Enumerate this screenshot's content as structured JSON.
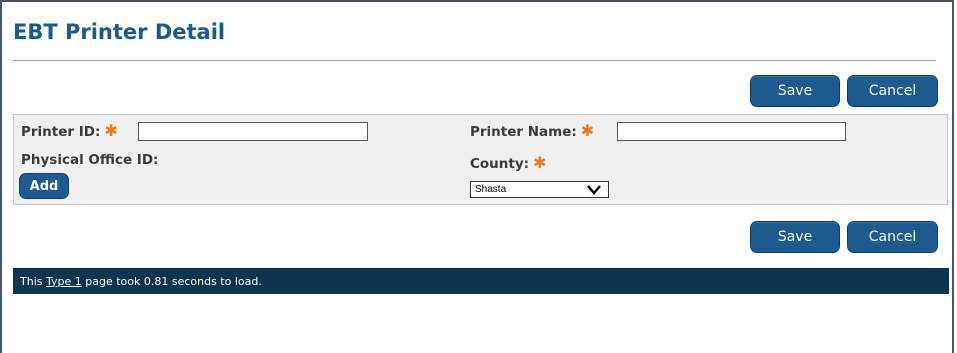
{
  "page": {
    "title": "EBT Printer Detail"
  },
  "toolbar_top": {
    "save_label": "Save",
    "cancel_label": "Cancel"
  },
  "form": {
    "printer_id": {
      "label": "Printer ID:",
      "required_mark": "✱",
      "value": ""
    },
    "printer_name": {
      "label": "Printer Name:",
      "required_mark": "✱",
      "value": ""
    },
    "physical_office_id": {
      "label": "Physical Office ID:",
      "add_label": "Add"
    },
    "county": {
      "label": "County:",
      "required_mark": "✱",
      "selected": "Shasta"
    }
  },
  "toolbar_bottom": {
    "save_label": "Save",
    "cancel_label": "Cancel"
  },
  "footer": {
    "prefix": "This ",
    "link_text": "Type 1",
    "suffix": " page took 0.81 seconds to load."
  },
  "colors": {
    "title": "#1b5a8c",
    "button": "#1d5a8f",
    "required": "#f07a1a",
    "footer_bg": "#0d3550",
    "panel_bg": "#f0f0f0"
  }
}
